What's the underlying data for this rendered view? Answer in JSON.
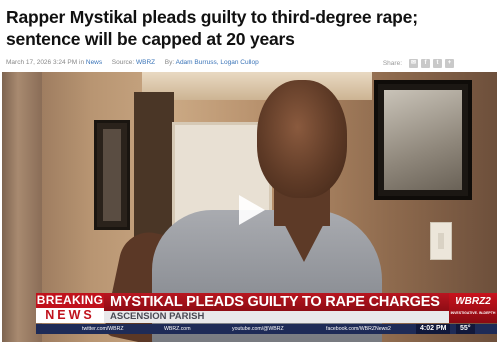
{
  "article": {
    "headline": "Rapper Mystikal pleads guilty to third-degree rape; sentence will be capped at 20 years",
    "date": "March 17, 2026 3:24 PM",
    "in_label": "in",
    "section": "News",
    "source_label": "Source:",
    "source": "WBRZ",
    "by_label": "By:",
    "authors": "Adam Burruss, Logan Cullop",
    "share_label": "Share:",
    "share_icons": [
      "email-icon",
      "facebook-icon",
      "twitter-icon",
      "more-icon"
    ],
    "share_glyphs": [
      "✉",
      "f",
      "t",
      "+"
    ]
  },
  "video": {
    "play_icon": "play-icon",
    "breaking_top": "BREAKING",
    "breaking_bottom": "NEWS",
    "ticker_headline": "MYSTIKAL PLEADS GUILTY TO RAPE CHARGES",
    "ticker_location": "ASCENSION PARISH",
    "station_logo": "WBRZ2",
    "station_tagline": "INVESTIGATIVE. IN-DEPTH",
    "social": {
      "twitter": "twitter.com/WBRZ",
      "web": "WBRZ.com",
      "youtube": "youtube.com/@WBRZ",
      "facebook": "facebook.com/WBRZNews2",
      "time": "4:02 PM",
      "temp": "55°"
    }
  },
  "colors": {
    "headline": "#111111",
    "link": "#3a74b8",
    "breaking_red": "#c0121c",
    "social_bar": "#1e2b57"
  }
}
